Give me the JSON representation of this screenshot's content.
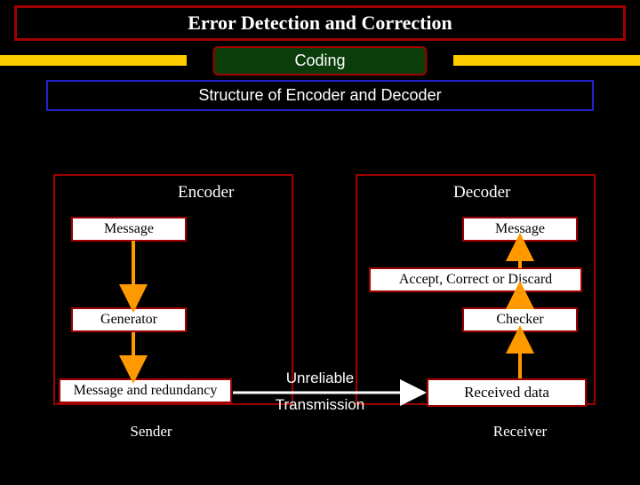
{
  "title": "Error Detection and Correction",
  "pill": "Coding",
  "subtitle": "Structure of Encoder and Decoder",
  "encoder": {
    "label": "Encoder",
    "message": "Message",
    "generator": "Generator",
    "msg_redundancy": "Message and redundancy",
    "caption": "Sender"
  },
  "decoder": {
    "label": "Decoder",
    "message": "Message",
    "acd": "Accept, Correct or Discard",
    "checker": "Checker",
    "received": "Received data",
    "caption": "Receiver"
  },
  "channel": {
    "line1": "Unreliable",
    "line2": "Transmission"
  },
  "colors": {
    "border_red": "#a00000",
    "accent_yellow": "#ffcc00",
    "pill_green": "#0a3d0a",
    "subtitle_blue": "#2222cc",
    "arrow_orange": "#ff9900"
  }
}
